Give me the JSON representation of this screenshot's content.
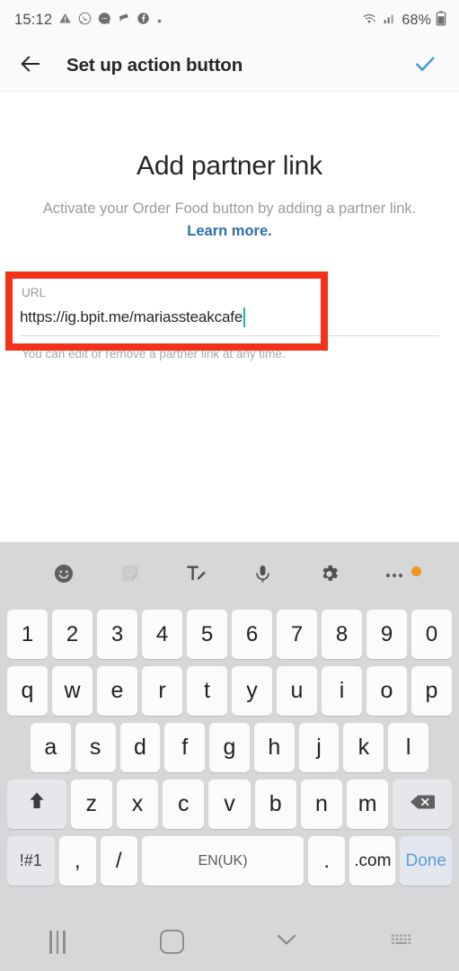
{
  "status_bar": {
    "time": "15:12",
    "battery_percent": "68%",
    "icons": [
      "warning-triangle-icon",
      "whatsapp-icon",
      "messages-icon",
      "pin-icon",
      "facebook-icon",
      "dot-icon"
    ],
    "right_icons": [
      "wifi-icon",
      "signal-icon",
      "battery-icon"
    ]
  },
  "app_bar": {
    "back_icon": "back-arrow-icon",
    "title": "Set up action button",
    "confirm_icon": "checkmark-icon",
    "confirm_color": "#3f9ad6"
  },
  "content": {
    "heading": "Add partner link",
    "subtitle": "Activate your Order Food button by adding a partner",
    "subtitle_line2": "link.",
    "learn_more": "Learn more.",
    "learn_more_color": "#2d70a8",
    "field": {
      "label": "URL",
      "value": "https://ig.bpit.me/mariassteakcafe",
      "placeholder": "URL",
      "caret_color": "#14b8a6",
      "help_text": "You can edit or remove a partner link at any time."
    },
    "annotation": {
      "shape": "rectangle",
      "color": "#f4321a"
    }
  },
  "keyboard": {
    "toolbar": [
      {
        "name": "emoji-icon"
      },
      {
        "name": "sticker-icon"
      },
      {
        "name": "text-edit-icon"
      },
      {
        "name": "microphone-icon"
      },
      {
        "name": "settings-gear-icon"
      },
      {
        "name": "more-options-icon",
        "badge": true,
        "badge_color": "#f59324"
      }
    ],
    "row_numbers": [
      "1",
      "2",
      "3",
      "4",
      "5",
      "6",
      "7",
      "8",
      "9",
      "0"
    ],
    "row_top": [
      "q",
      "w",
      "e",
      "r",
      "t",
      "y",
      "u",
      "i",
      "o",
      "p"
    ],
    "row_home": [
      "a",
      "s",
      "d",
      "f",
      "g",
      "h",
      "j",
      "k",
      "l"
    ],
    "row_bottom": [
      "z",
      "x",
      "c",
      "v",
      "b",
      "n",
      "m"
    ],
    "shift_icon": "shift-up-arrow-icon",
    "backspace_icon": "backspace-icon",
    "row_function": {
      "symbols": "!#1",
      "comma": ",",
      "slash": "/",
      "space": "EN(UK)",
      "period": ".",
      "dotcom": ".com",
      "done": "Done"
    }
  },
  "nav_bar": {
    "recents": "recents-icon",
    "home": "home-icon",
    "back": "chevron-down-icon",
    "keyboard_switch": "keyboard-switch-icon"
  }
}
